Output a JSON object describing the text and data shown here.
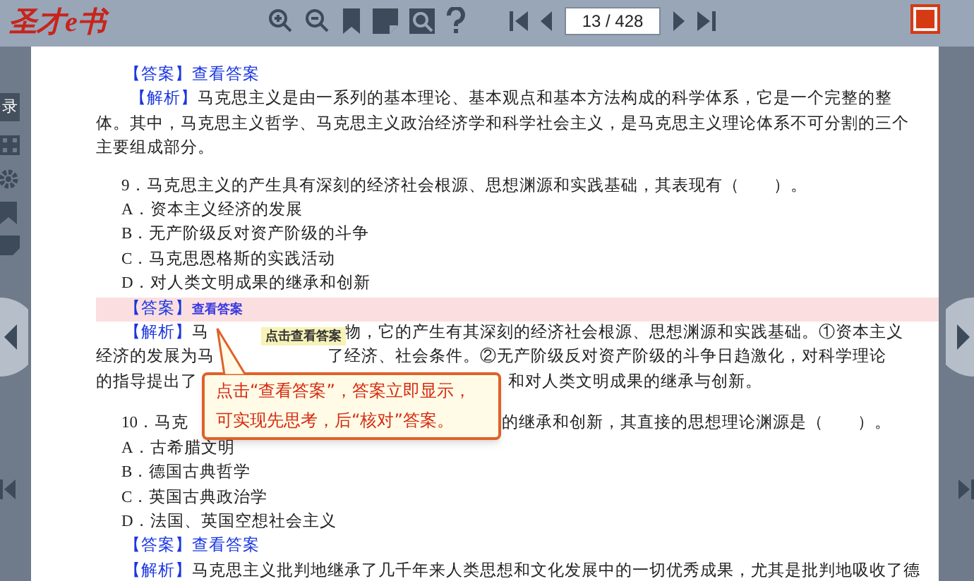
{
  "toolbar": {
    "logo": "圣才e书",
    "page_field": "13 / 428"
  },
  "sidebar": {
    "tab_label": "录"
  },
  "page": {
    "block1": {
      "answer_tag": "【答案】",
      "answer_link": "查看答案",
      "analysis": "**【解析】**马克思主义是由一系列的基本理论、基本观点和基本方法构成的科学体系，它是一个完整的整体。其中，马克思主义哲学、马克思主义政治经济学和科学社会主义，是马克思主义理论体系不可分割的三个主要组成部分。"
    },
    "question9": {
      "stem": "9．马克思主义的产生具有深刻的经济社会根源、思想渊源和实践基础，其表现有（　　）。",
      "options": [
        "A．资本主义经济的发展",
        "B．无产阶级反对资产阶级的斗争",
        "C．马克思恩格斯的实践活动",
        "D．对人类文明成果的继承和创新"
      ],
      "answer_tag": "【答案】",
      "answer_link": "查看答案",
      "highlighted": true,
      "analysis_lines": [
        {
          "start": "**【解析】**马",
          "end": "物，它的产生有其深刻的经济社会根源、思想渊源和实践基础。①资本主义"
        },
        {
          "start": "经济的发展为马",
          "end": "了经济、社会条件。②无产阶级反对资产阶级的斗争日趋激化，对科学理论"
        },
        {
          "start": "的指导提出了",
          "end": "和对人类文明成果的继承与创新。"
        }
      ]
    },
    "question10": {
      "stem_start": "10．马克",
      "stem_end": "的继承和创新，其直接的思想理论渊源是（　　）。",
      "options": [
        "A．古希腊文明",
        "B．德国古典哲学",
        "C．英国古典政治学",
        "D．法国、英国空想社会主义"
      ],
      "answer_tag": "【答案】",
      "answer_link": "查看答案",
      "analysis": "**【解析】**马克思主义批判地继承了几千年来人类思想和文化发展中的一切优秀成果，尤其是批判地吸收了德"
    }
  },
  "tooltip": "点击查看答案",
  "callout": {
    "lines": [
      "点击“查看答案”，答案立即显示，",
      "可实现先思考，后“核对”答案。"
    ]
  }
}
